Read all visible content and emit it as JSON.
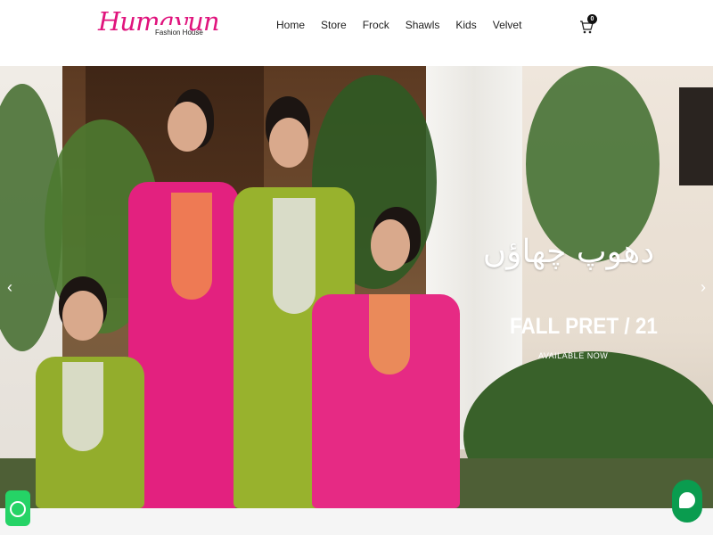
{
  "brand": {
    "logo_script": "Humayun",
    "logo_sub": "Fashion House",
    "accent_color": "#e0147d"
  },
  "nav": {
    "items": [
      "Home",
      "Store",
      "Frock",
      "Shawls",
      "Kids",
      "Velvet"
    ]
  },
  "cart": {
    "icon": "cart-icon",
    "count": "0"
  },
  "hero": {
    "urdu_title": "دھوپ چھاؤں",
    "promo_title": "FALL PRET / 21",
    "promo_subtitle": "AVAILABLE NOW",
    "prev_icon": "chevron-left-icon",
    "next_icon": "chevron-right-icon"
  },
  "floating": {
    "whatsapp_icon": "whatsapp-icon",
    "chat_icon": "chat-icon"
  }
}
